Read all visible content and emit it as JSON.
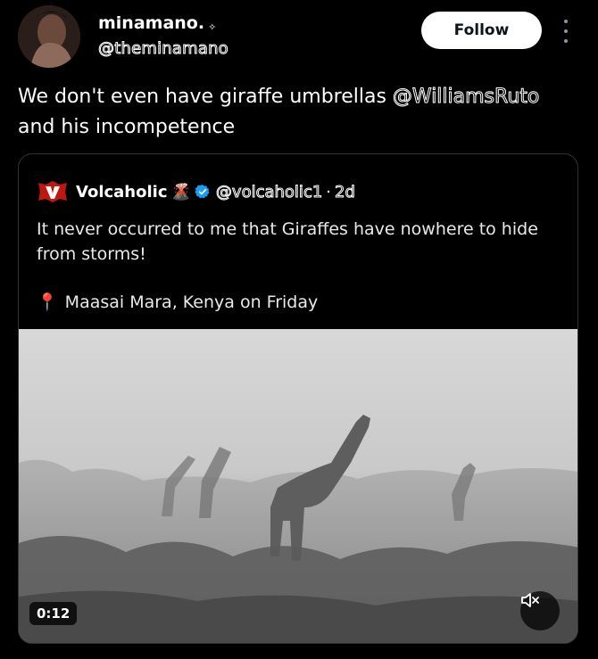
{
  "author": {
    "display_name": "minamano.",
    "name_suffix": "✧",
    "handle": "@theminamano"
  },
  "follow_label": "Follow",
  "post": {
    "text_before": "We don't even have giraffe umbrellas ",
    "mention": "@WilliamsRuto",
    "text_after": " and his incompetence"
  },
  "quote": {
    "display_name": "Volcaholic",
    "name_emoji": "🌋",
    "handle": "@volcaholic1",
    "separator": "·",
    "time": "2d",
    "text": "It never occurred to me that Giraffes have nowhere to hide from storms!",
    "location_pin": "📍",
    "location": "Maasai Mara, Kenya on Friday",
    "video_duration": "0:12"
  },
  "colors": {
    "background": "#000000",
    "follow_bg": "#ffffff",
    "verified_blue": "#1d9bf0",
    "border": "#2f3336"
  },
  "icons": {
    "more": "more-vertical-icon",
    "verified": "verified-badge-icon",
    "mute": "volume-muted-icon"
  }
}
